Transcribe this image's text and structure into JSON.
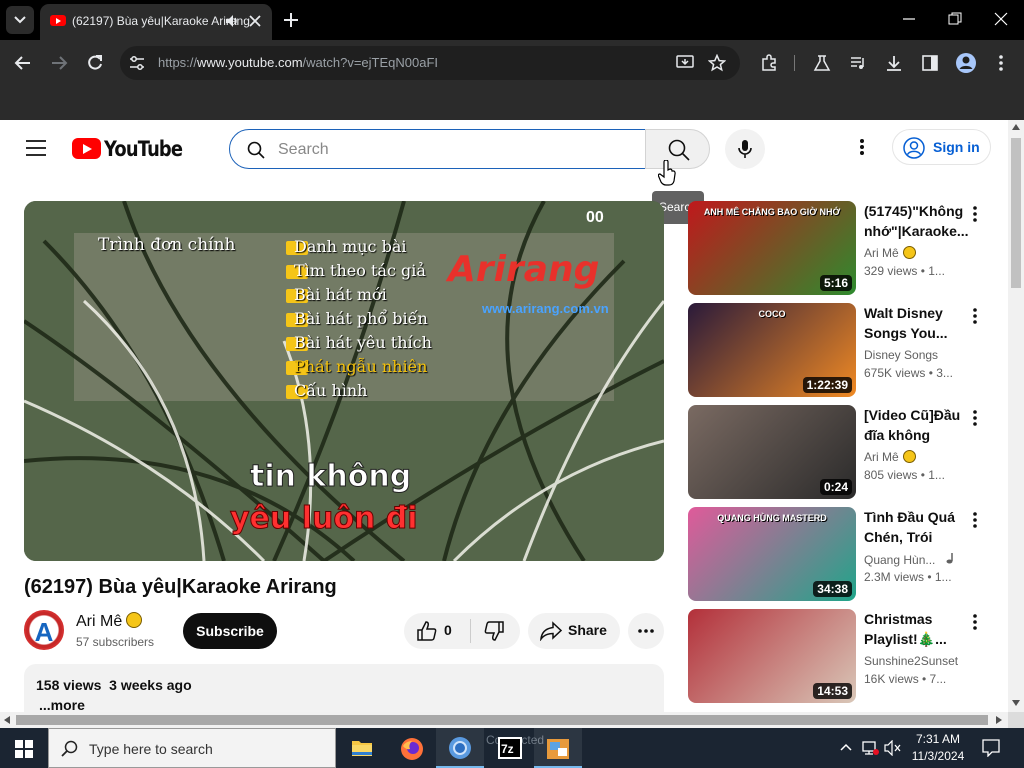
{
  "browser": {
    "tab_title": "(62197) Bùa yêu|Karaoke Arirang - YouTube",
    "url_prefix": "https://",
    "url_host": "www.youtube.com",
    "url_path": "/watch?v=ejTEqN00aFI"
  },
  "header": {
    "logo_text": "YouTube",
    "search_placeholder": "Search",
    "search_tooltip": "Search",
    "signin_label": "Sign in"
  },
  "player": {
    "menu_title": "Trình đơn chính",
    "menu_items": [
      "Danh mục bài",
      "Tìm theo tác giả",
      "Bài hát mới",
      "Bài hát phổ biến",
      "Bài hát yêu thích",
      "Phát ngẫu nhiên",
      "Cấu hình"
    ],
    "brand": "Arirang",
    "brand_url": "www.arirang.com.vn",
    "counter": "00",
    "lyric_line1": "tin không",
    "lyric_line2": "yêu luôn đi"
  },
  "video": {
    "title": "(62197) Bùa yêu|Karaoke Arirang",
    "avatar_letter": "A",
    "channel": "Ari Mê",
    "subscribers": "57 subscribers",
    "subscribe_label": "Subscribe",
    "like_count": "0",
    "share_label": "Share",
    "views": "158 views",
    "age": "3 weeks ago",
    "more_label": "...more"
  },
  "recommendations": [
    {
      "title": "(51745)\"Không nhớ\"|Karaoke...",
      "channel": "Ari Mê",
      "badge": true,
      "meta": "329 views • 1...",
      "duration": "5:16",
      "thumb_text": "ANH MÊ CHẲNG BAO GIỜ NHỚ",
      "thumb_colors": [
        "#c0181c",
        "#2e8b2e"
      ]
    },
    {
      "title": "Walt Disney Songs You...",
      "channel": "Disney Songs",
      "badge": false,
      "meta": "675K views • 3...",
      "duration": "1:22:39",
      "thumb_text": "COCO",
      "thumb_colors": [
        "#2a1a3a",
        "#f08a24"
      ]
    },
    {
      "title": "[Video Cũ]Đầu đĩa không thíc...",
      "channel": "Ari Mê",
      "badge": true,
      "meta": "805 views • 1...",
      "duration": "0:24",
      "thumb_text": "",
      "thumb_colors": [
        "#7a6a62",
        "#2a2a2a"
      ]
    },
    {
      "title": "Tình Đầu Quá Chén, Trói Em...",
      "channel": "Quang Hùn...",
      "badge": false,
      "music": true,
      "meta": "2.3M views • 1...",
      "duration": "34:38",
      "thumb_text": "QUANG HÙNG MASTERD",
      "thumb_colors": [
        "#e05a9a",
        "#1fa58a"
      ]
    },
    {
      "title": "Christmas Playlist!🎄...",
      "channel": "Sunshine2Sunset",
      "badge": false,
      "meta": "16K views • 7...",
      "duration": "14:53",
      "thumb_text": "",
      "thumb_colors": [
        "#b3303a",
        "#d9c7b8"
      ]
    }
  ],
  "taskbar": {
    "search_placeholder": "Type here to search",
    "time": "7:31 AM",
    "date": "11/3/2024",
    "ghost_text": "Connected"
  },
  "colors": {
    "yt_red": "#ff0000",
    "link_blue": "#065fd4",
    "chrome_dark": "#2b2b2b",
    "taskbar": "#1b2532"
  }
}
